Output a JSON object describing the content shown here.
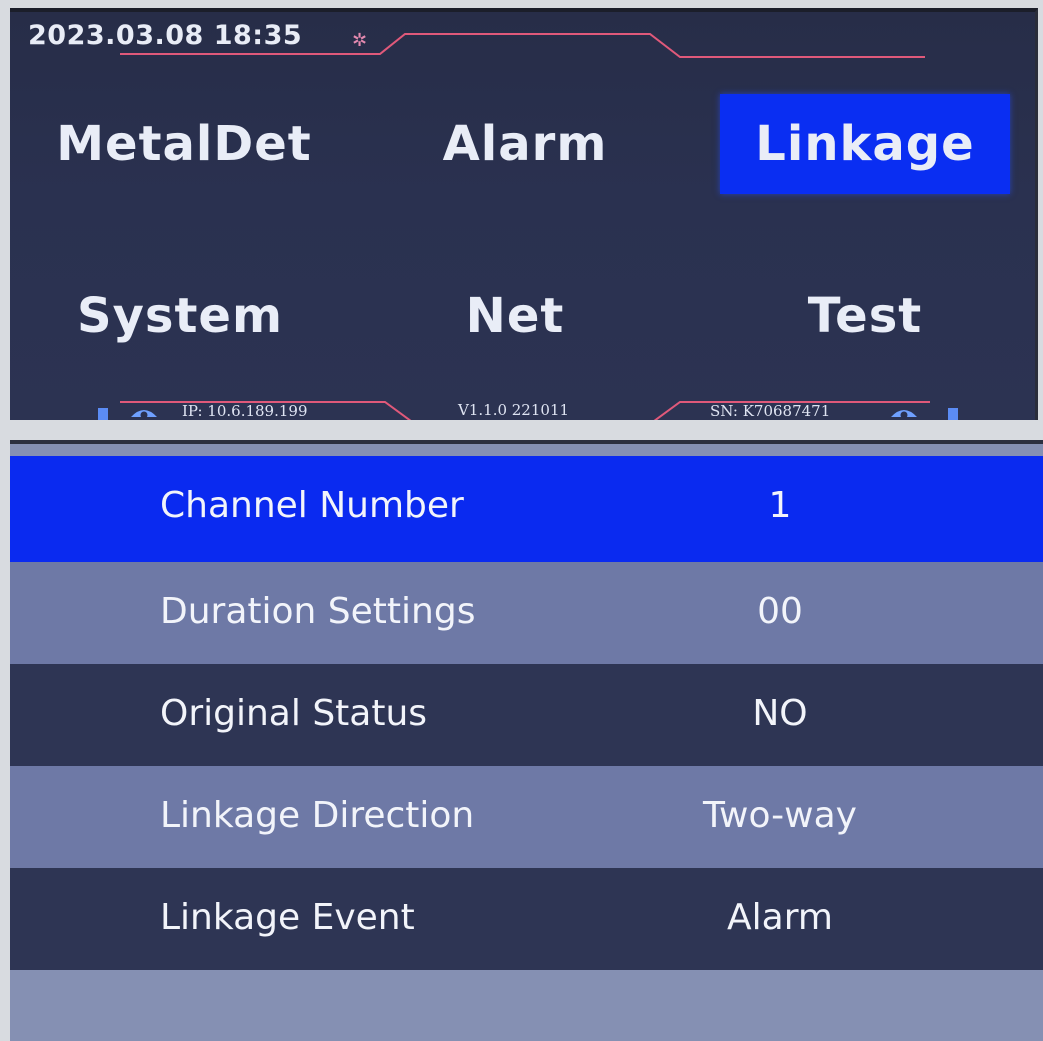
{
  "header": {
    "datetime": "2023.03.08 18:35",
    "link_icon": "link-icon"
  },
  "menu": {
    "items": [
      {
        "label": "MetalDet",
        "active": false
      },
      {
        "label": "Alarm",
        "active": false
      },
      {
        "label": "Linkage",
        "active": true
      },
      {
        "label": "System",
        "active": false
      },
      {
        "label": "Net",
        "active": false
      },
      {
        "label": "Test",
        "active": false
      }
    ]
  },
  "footer": {
    "ip": "IP: 10.6.189.199",
    "version": "V1.1.0 221011",
    "sn": "SN: K70687471"
  },
  "linkage_settings": {
    "rows": [
      {
        "label": "Channel Number",
        "value": "1",
        "selected": true
      },
      {
        "label": "Duration Settings",
        "value": "00",
        "selected": false
      },
      {
        "label": "Original Status",
        "value": "NO",
        "selected": false
      },
      {
        "label": "Linkage Direction",
        "value": "Two-way",
        "selected": false
      },
      {
        "label": "Linkage Event",
        "value": "Alarm",
        "selected": false
      }
    ]
  },
  "colors": {
    "active_highlight": "#0a2ef2",
    "screen_background": "#2a3150",
    "accent_line": "#e0597a",
    "row_dark": "#2e3554",
    "row_light": "#6e79a6"
  }
}
